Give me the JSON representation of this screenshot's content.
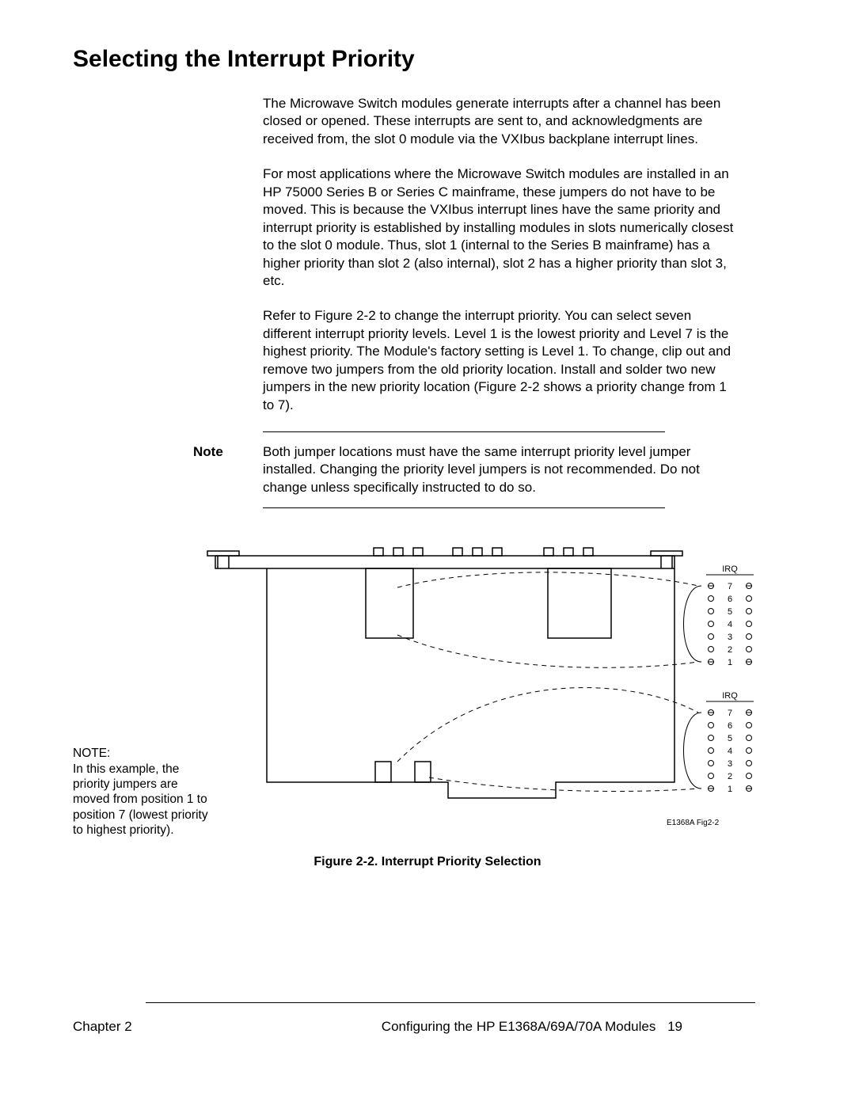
{
  "title": "Selecting the Interrupt Priority",
  "para1": "The Microwave Switch modules generate interrupts after a channel has been closed or opened.  These interrupts are sent to, and acknowledgments are received from, the slot 0 module via the VXIbus backplane interrupt lines.",
  "para2": "For most applications where the Microwave Switch modules are installed in an HP 75000 Series B or Series C mainframe, these jumpers do not have to be moved.  This is because the VXIbus interrupt lines have the same priority and interrupt priority is established by installing modules in slots numerically closest to the slot 0 module.  Thus, slot 1 (internal to the Series B mainframe) has a higher priority than slot 2 (also internal), slot 2 has a higher priority than slot 3, etc.",
  "para3": "Refer to Figure 2-2 to change the interrupt priority.  You can select seven different interrupt priority levels.  Level 1 is the lowest priority and Level 7 is the highest priority.  The Module's factory setting is Level 1.  To change, clip out and remove two jumpers from the old priority location.  Install and solder two new jumpers in the new priority location (Figure 2-2 shows a priority change from 1 to 7).",
  "note_label": "Note",
  "note_text": "Both jumper locations must have the same interrupt priority level jumper installed.  Changing the priority level jumpers is not recommended.  Do not change unless specifically instructed to do so.",
  "fig_note_head": "NOTE:",
  "fig_note_body": "In this example, the priority jumpers are moved from position 1 to position 7 (lowest priority to highest priority).",
  "caption": "Figure 2-2.  Interrupt Priority Selection",
  "footer_left": "Chapter 2",
  "footer_right": "Configuring the HP E1368A/69A/70A Modules",
  "page_number": "19",
  "irq_label": "IRQ",
  "irq_levels": [
    "7",
    "6",
    "5",
    "4",
    "3",
    "2",
    "1"
  ],
  "fig_id": "E1368A  Fig2-2"
}
